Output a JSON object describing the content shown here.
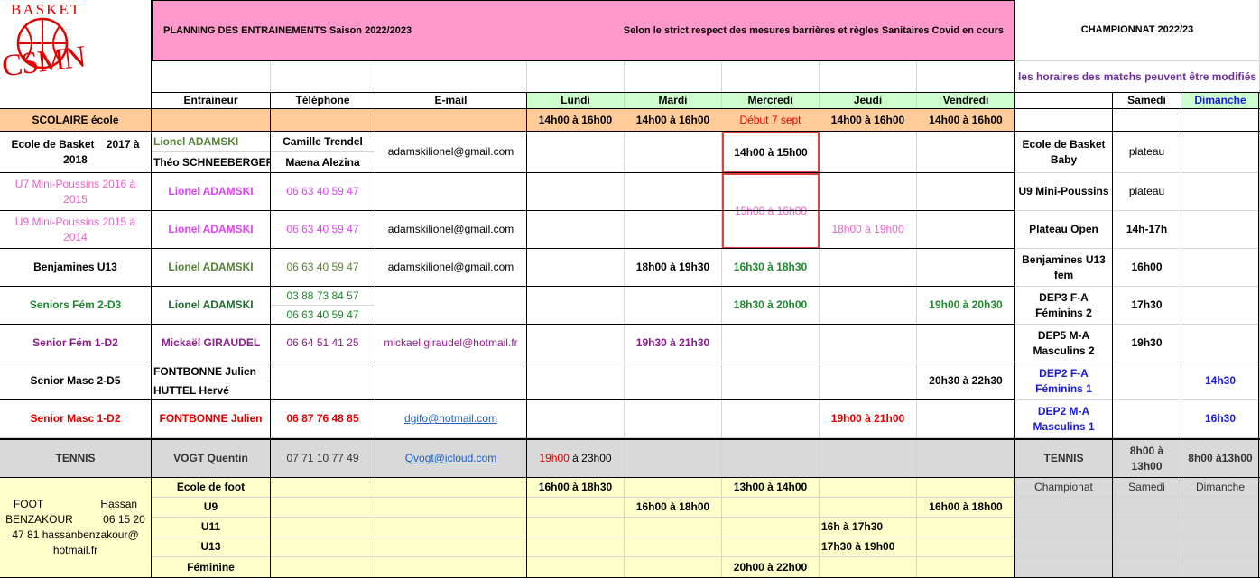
{
  "logo": {
    "top": "BASKET",
    "bottom": "CSMN"
  },
  "header": {
    "title": "PLANNING DES ENTRAINEMENTS Saison 2022/2023",
    "covid_note": "Selon le strict respect des mesures barrières et règles Sanitaires Covid en cours",
    "championnat": "CHAMPIONNAT 2022/23",
    "match_note": "les horaires des matchs peuvent être modifiés"
  },
  "columns": {
    "entraineur": "Entraineur",
    "telephone": "Téléphone",
    "email": "E-mail",
    "lundi": "Lundi",
    "mardi": "Mardi",
    "mercredi": "Mercredi",
    "jeudi": "Jeudi",
    "vendredi": "Vendredi",
    "samedi": "Samedi",
    "dimanche": "Dimanche"
  },
  "scolaire": {
    "label": "SCOLAIRE école",
    "lundi": "14h00 à 16h00",
    "mardi": "14h00 à 16h00",
    "mercredi": "Début 7 sept",
    "jeudi": "14h00 à 16h00",
    "vendredi": "14h00 à 16h00"
  },
  "rows": {
    "ecole": {
      "label": "Ecole de Basket    2017 à 2018",
      "coach1": "Lionel ADAMSKI",
      "coach2": "Théo SCHNEEBERGER",
      "phone1": "Camille Trendel",
      "phone2": "Maena Alezina",
      "email": "adamskilionel@gmail.com",
      "mercredi": "14h00 à 15h00",
      "champ": "Ecole de Basket Baby",
      "samedi": "plateau"
    },
    "u7": {
      "label": "U7 Mini-Poussins  2016 à 2015",
      "coach": "Lionel ADAMSKI",
      "phone": "06 63 40 59 47",
      "champ": "U9 Mini-Poussins",
      "samedi": "plateau"
    },
    "u9": {
      "label": "U9 Mini-Poussins   2015 à 2014",
      "coach": "Lionel ADAMSKI",
      "phone": "06 63 40 59 47",
      "email": "adamskilionel@gmail.com",
      "jeudi": "18h00 à 19h00",
      "champ": "Plateau Open",
      "samedi": "14h-17h"
    },
    "u7u9_mercredi": "15h00 à 16h00",
    "u13": {
      "label": "Benjamines U13",
      "coach": "Lionel ADAMSKI",
      "phone": "06 63 40 59 47",
      "email": "adamskilionel@gmail.com",
      "mardi": "18h00 à 19h30",
      "mercredi": "16h30 à 18h30",
      "champ": "Benjamines U13 fem",
      "samedi": "16h00"
    },
    "sf2": {
      "label": "Seniors Fém 2-D3",
      "coach": "Lionel ADAMSKI",
      "phone1": "03 88 73 84 57",
      "phone2": "06 63 40 59 47",
      "mercredi": "18h30 à 20h00",
      "vendredi": "19h00 à 20h30",
      "champ": "DEP3 F-A Féminins 2",
      "samedi": "17h30"
    },
    "sf1": {
      "label": "Senior Fém 1-D2",
      "coach": "Mickaël GIRAUDEL",
      "phone": "06 64 51 41 25",
      "email": "mickael.giraudel@hotmail.fr",
      "mardi": "19h30 à 21h30",
      "champ": "DEP5 M-A Masculins 2",
      "samedi": "19h30"
    },
    "sm2": {
      "label": "Senior Masc 2-D5",
      "coach1": "FONTBONNE Julien",
      "coach2": "HUTTEL Hervé",
      "vendredi": "20h30 à 22h30",
      "champ": "DEP2 F-A Féminins 1",
      "dimanche": "14h30"
    },
    "sm1": {
      "label": "Senior Masc 1-D2",
      "coach": "FONTBONNE Julien",
      "phone": "06 87 76 48 85",
      "email": "dgifo@hotmail.com",
      "jeudi": "19h00 à 21h00",
      "champ": "DEP2 M-A Masculins 1",
      "dimanche": "16h30"
    }
  },
  "tennis": {
    "label": "TENNIS",
    "coach": "VOGT Quentin",
    "phone": "07 71 10 77 49",
    "email": "Qvogt@icloud.com",
    "lundi_start": "19h00",
    "lundi_end": " à 23h00",
    "champ_label": "TENNIS",
    "samedi": "8h00 à 13h00",
    "dimanche": "8h00 à13h00",
    "sub_champ": "Championat",
    "sub_samedi": "Samedi",
    "sub_dimanche": "Dimanche"
  },
  "foot": {
    "contact": "FOOT                   Hassan BENZAKOUR          06 15 20 47 81 hassanbenzakour@ hotmail.fr",
    "rows": [
      {
        "label": "Ecole de foot",
        "lundi": "16h00 à 18h30",
        "mercredi": "13h00 à 14h00"
      },
      {
        "label": "U9",
        "mardi": "16h00 à 18h00",
        "vendredi": "16h00 à 18h00"
      },
      {
        "label": "U11",
        "jeudi": "16h à 17h30"
      },
      {
        "label": "U13",
        "jeudi": "17h30 à 19h00"
      },
      {
        "label": "Féminine",
        "mercredi": "20h00 à 22h00"
      }
    ]
  }
}
